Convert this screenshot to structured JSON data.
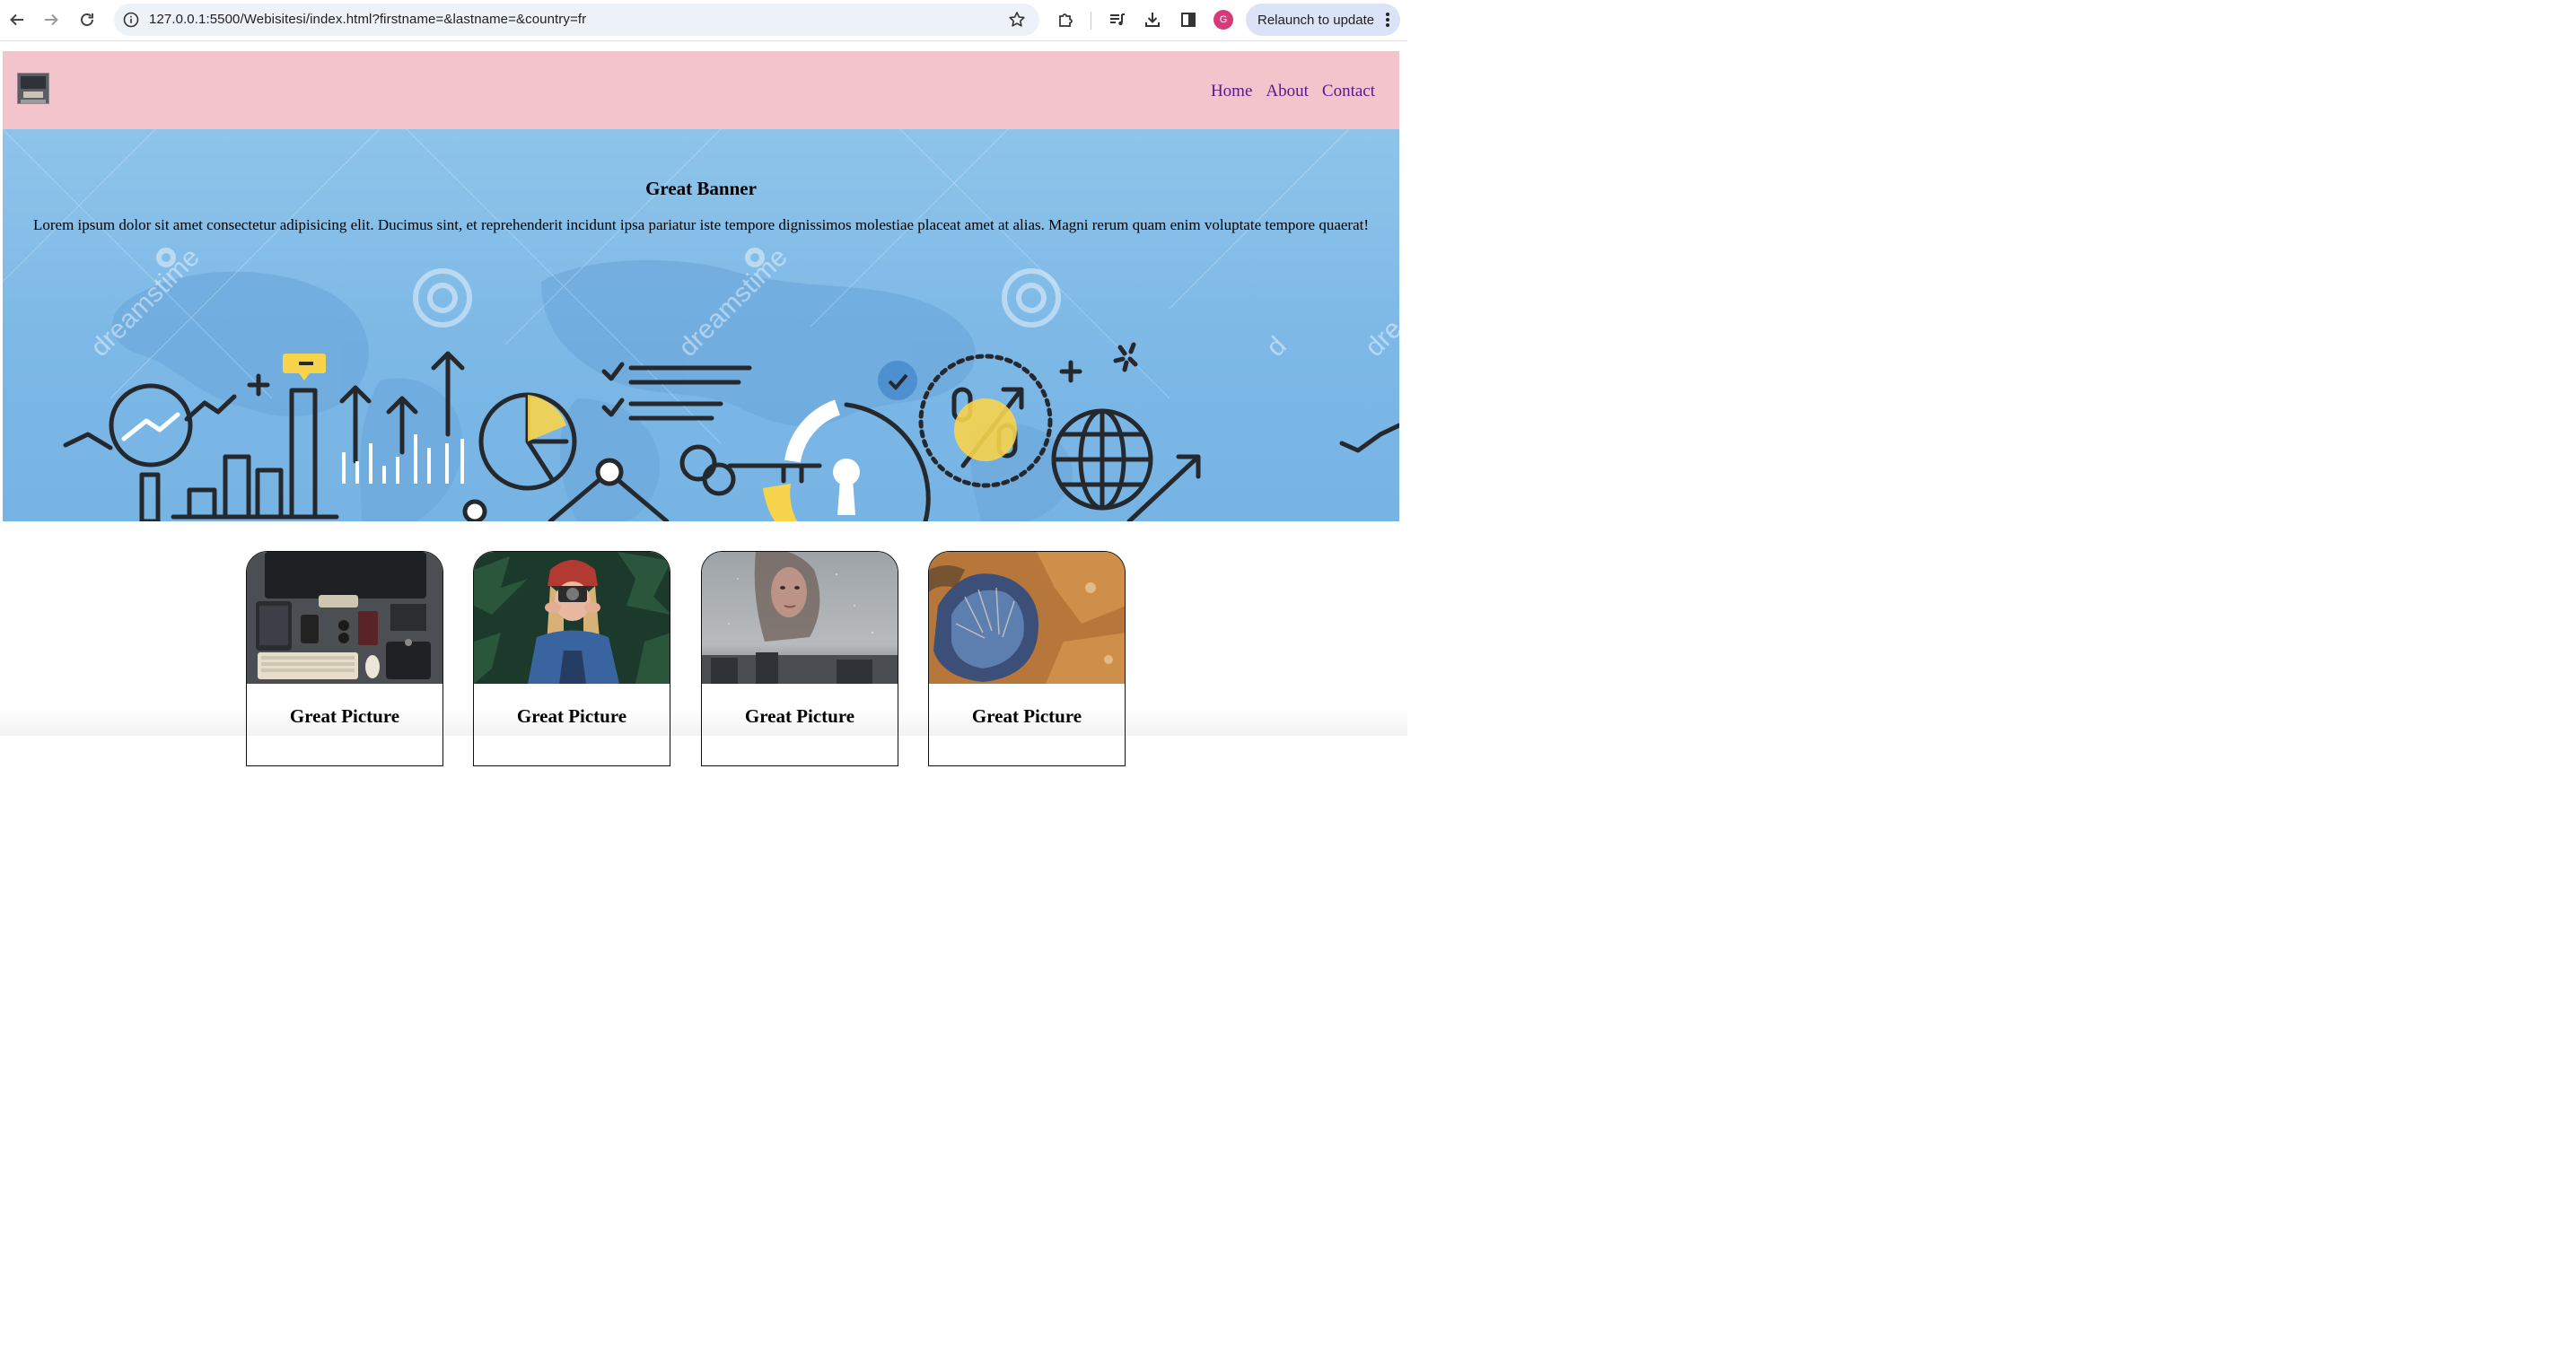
{
  "browser": {
    "url": "127.0.0.1:5500/Webisitesi/index.html?firstname=&lastname=&country=fr",
    "profile_initial": "G",
    "relaunch_label": "Relaunch to update"
  },
  "header": {
    "nav": [
      {
        "label": "Home"
      },
      {
        "label": "About"
      },
      {
        "label": "Contact"
      }
    ]
  },
  "banner": {
    "title": "Great Banner",
    "text": "Lorem ipsum dolor sit amet consectetur adipisicing elit. Ducimus sint, et reprehenderit incidunt ipsa pariatur iste tempore dignissimos molestiae placeat amet at alias. Magni rerum quam enim voluptate tempore quaerat!",
    "watermark": "dreamstime",
    "accent_color": "#f7d44c",
    "line_color": "#25282d"
  },
  "cards": [
    {
      "title": "Great Picture",
      "image": "desk-workspace-photo"
    },
    {
      "title": "Great Picture",
      "image": "woman-with-camera-photo"
    },
    {
      "title": "Great Picture",
      "image": "woman-behind-window-photo"
    },
    {
      "title": "Great Picture",
      "image": "aerial-crater-photo"
    }
  ],
  "colors": {
    "header_bg": "#f4c4cc",
    "banner_bg": "#7db8e6",
    "link": "#551a8b"
  }
}
